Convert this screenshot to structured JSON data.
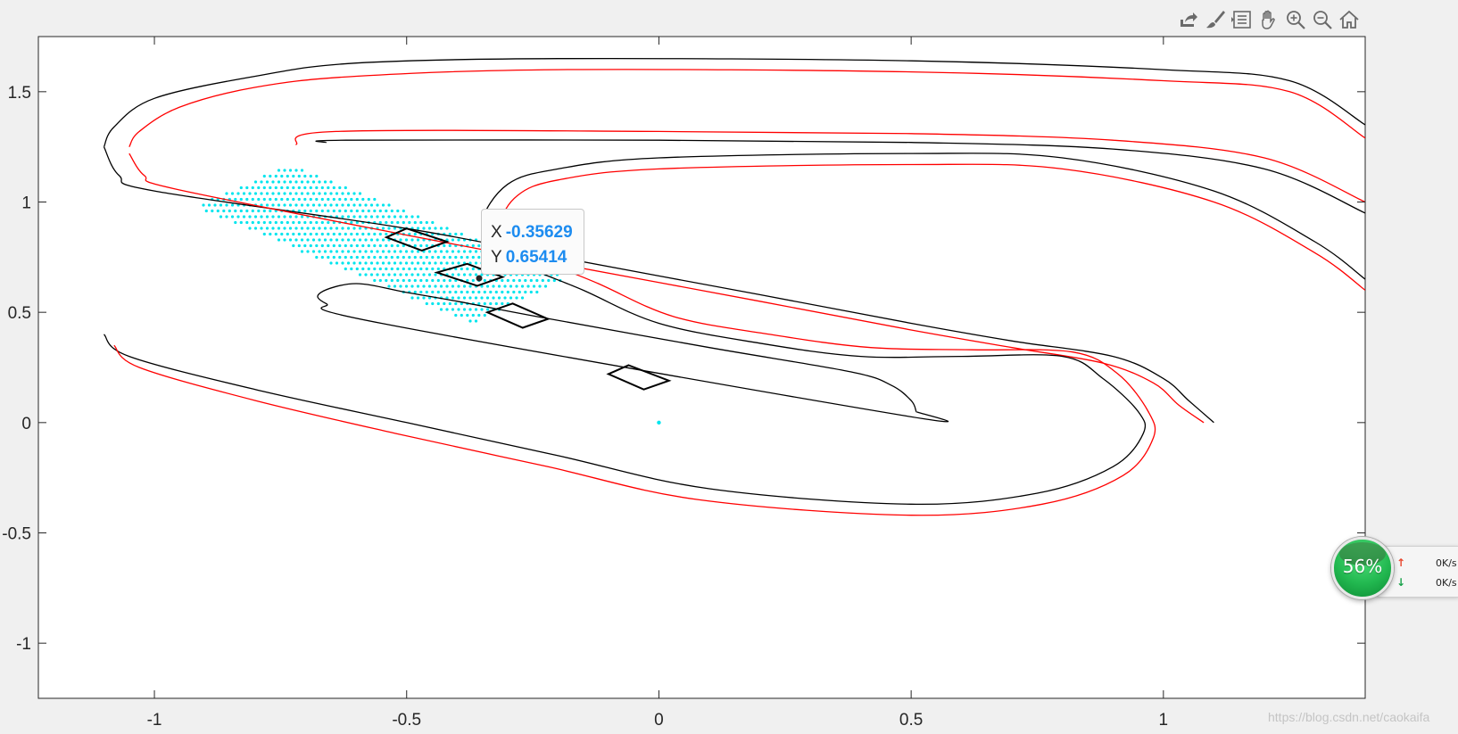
{
  "toolbar": {
    "icons": [
      "export-icon",
      "brush-icon",
      "legend-icon",
      "pan-hand-icon",
      "zoom-in-icon",
      "zoom-out-icon",
      "home-icon"
    ]
  },
  "chart_data": {
    "type": "line",
    "title": "",
    "xlabel": "",
    "ylabel": "",
    "xlim": [
      -1.23,
      1.4
    ],
    "ylim": [
      -1.25,
      1.75
    ],
    "xticks": [
      -1,
      -0.5,
      0,
      0.5,
      1
    ],
    "xtick_labels": [
      "-1",
      "-0.5",
      "0",
      "0.5",
      "1"
    ],
    "yticks": [
      1.5,
      1,
      0.5,
      0,
      -0.5,
      -1
    ],
    "ytick_labels": [
      "1.5",
      "1",
      "0.5",
      "0",
      "-0.5",
      "-1"
    ],
    "grid": false,
    "colors": {
      "boundary": "#000000",
      "offset": "#ff0000",
      "samples": "#00e5ee"
    },
    "series": [
      {
        "color": "#000000",
        "points": [
          [
            0.51,
            0.05
          ],
          [
            0.49,
            0.03
          ],
          [
            -0.55,
            0.45
          ],
          [
            -0.66,
            0.54
          ],
          [
            -0.67,
            0.59
          ],
          [
            -0.6,
            0.63
          ],
          [
            -0.5,
            0.59
          ],
          [
            -0.4,
            0.55
          ],
          [
            -0.24,
            0.48
          ],
          [
            0.1,
            0.34
          ],
          [
            0.38,
            0.23
          ],
          [
            0.46,
            0.17
          ],
          [
            0.5,
            0.1
          ],
          [
            0.51,
            0.05
          ]
        ]
      },
      {
        "color": "#000000",
        "points": [
          [
            -1.1,
            1.25
          ],
          [
            -1.08,
            1.34
          ],
          [
            -1.0,
            1.47
          ],
          [
            -0.8,
            1.57
          ],
          [
            -0.6,
            1.63
          ],
          [
            -0.2,
            1.65
          ],
          [
            0.5,
            1.64
          ],
          [
            1.0,
            1.6
          ],
          [
            1.25,
            1.55
          ],
          [
            1.4,
            1.35
          ]
        ]
      },
      {
        "color": "#ff0000",
        "points": [
          [
            -1.05,
            1.25
          ],
          [
            -1.03,
            1.32
          ],
          [
            -0.95,
            1.43
          ],
          [
            -0.8,
            1.52
          ],
          [
            -0.6,
            1.57
          ],
          [
            -0.2,
            1.6
          ],
          [
            0.5,
            1.59
          ],
          [
            1.0,
            1.55
          ],
          [
            1.25,
            1.5
          ],
          [
            1.4,
            1.29
          ]
        ]
      },
      {
        "color": "#000000",
        "points": [
          [
            -1.1,
            1.25
          ],
          [
            -1.07,
            1.12
          ],
          [
            -1.0,
            1.05
          ],
          [
            -0.5,
            0.88
          ],
          [
            -0.2,
            0.75
          ],
          [
            0.2,
            0.58
          ],
          [
            0.5,
            0.45
          ],
          [
            0.7,
            0.37
          ],
          [
            0.9,
            0.3
          ],
          [
            1.0,
            0.2
          ],
          [
            1.05,
            0.1
          ],
          [
            1.1,
            0.0
          ]
        ]
      },
      {
        "color": "#ff0000",
        "points": [
          [
            -1.05,
            1.22
          ],
          [
            -1.02,
            1.12
          ],
          [
            -0.96,
            1.06
          ],
          [
            -0.5,
            0.85
          ],
          [
            -0.2,
            0.72
          ],
          [
            0.2,
            0.55
          ],
          [
            0.5,
            0.42
          ],
          [
            0.7,
            0.34
          ],
          [
            0.88,
            0.27
          ],
          [
            0.98,
            0.18
          ],
          [
            1.03,
            0.08
          ],
          [
            1.08,
            0.0
          ]
        ]
      },
      {
        "color": "#000000",
        "points": [
          [
            -0.66,
            1.27
          ],
          [
            -0.62,
            1.28
          ],
          [
            0.0,
            1.28
          ],
          [
            0.5,
            1.27
          ],
          [
            0.9,
            1.24
          ],
          [
            1.2,
            1.15
          ],
          [
            1.4,
            0.95
          ]
        ]
      },
      {
        "color": "#ff0000",
        "points": [
          [
            -0.72,
            1.26
          ],
          [
            -0.64,
            1.32
          ],
          [
            0.0,
            1.32
          ],
          [
            0.5,
            1.31
          ],
          [
            0.9,
            1.28
          ],
          [
            1.2,
            1.2
          ],
          [
            1.4,
            1.0
          ]
        ]
      },
      {
        "color": "#000000",
        "points": [
          [
            1.4,
            0.65
          ],
          [
            1.3,
            0.82
          ],
          [
            1.1,
            1.05
          ],
          [
            0.8,
            1.2
          ],
          [
            0.5,
            1.22
          ],
          [
            0.0,
            1.2
          ],
          [
            -0.2,
            1.15
          ],
          [
            -0.3,
            1.08
          ],
          [
            -0.35,
            0.9
          ],
          [
            -0.3,
            0.75
          ],
          [
            -0.15,
            0.6
          ],
          [
            0.0,
            0.45
          ],
          [
            0.2,
            0.36
          ],
          [
            0.4,
            0.3
          ],
          [
            0.6,
            0.3
          ],
          [
            0.8,
            0.3
          ],
          [
            0.88,
            0.2
          ],
          [
            0.95,
            0.05
          ],
          [
            0.96,
            -0.05
          ],
          [
            0.9,
            -0.2
          ],
          [
            0.75,
            -0.32
          ],
          [
            0.5,
            -0.37
          ],
          [
            0.1,
            -0.3
          ],
          [
            -0.2,
            -0.15
          ],
          [
            -0.5,
            0.0
          ],
          [
            -0.8,
            0.15
          ],
          [
            -1.05,
            0.3
          ],
          [
            -1.1,
            0.4
          ]
        ]
      },
      {
        "color": "#ff0000",
        "points": [
          [
            1.4,
            0.6
          ],
          [
            1.3,
            0.77
          ],
          [
            1.1,
            1.0
          ],
          [
            0.8,
            1.15
          ],
          [
            0.5,
            1.17
          ],
          [
            0.0,
            1.15
          ],
          [
            -0.2,
            1.1
          ],
          [
            -0.28,
            1.03
          ],
          [
            -0.31,
            0.9
          ],
          [
            -0.26,
            0.77
          ],
          [
            -0.12,
            0.63
          ],
          [
            0.03,
            0.48
          ],
          [
            0.22,
            0.4
          ],
          [
            0.42,
            0.34
          ],
          [
            0.62,
            0.33
          ],
          [
            0.82,
            0.32
          ],
          [
            0.91,
            0.22
          ],
          [
            0.97,
            0.05
          ],
          [
            0.98,
            -0.07
          ],
          [
            0.92,
            -0.24
          ],
          [
            0.76,
            -0.37
          ],
          [
            0.5,
            -0.42
          ],
          [
            0.08,
            -0.35
          ],
          [
            -0.22,
            -0.2
          ],
          [
            -0.52,
            -0.05
          ],
          [
            -0.8,
            0.1
          ],
          [
            -1.03,
            0.25
          ],
          [
            -1.08,
            0.35
          ]
        ]
      }
    ],
    "rectangles": [
      {
        "color": "#000000",
        "corners": [
          [
            -0.5,
            0.88
          ],
          [
            -0.42,
            0.82
          ],
          [
            -0.47,
            0.78
          ],
          [
            -0.54,
            0.84
          ]
        ]
      },
      {
        "color": "#000000",
        "corners": [
          [
            -0.38,
            0.72
          ],
          [
            -0.31,
            0.66
          ],
          [
            -0.36,
            0.62
          ],
          [
            -0.44,
            0.68
          ]
        ]
      },
      {
        "color": "#000000",
        "corners": [
          [
            -0.29,
            0.54
          ],
          [
            -0.22,
            0.47
          ],
          [
            -0.27,
            0.43
          ],
          [
            -0.34,
            0.5
          ]
        ]
      },
      {
        "color": "#000000",
        "corners": [
          [
            -0.06,
            0.26
          ],
          [
            0.02,
            0.19
          ],
          [
            -0.03,
            0.15
          ],
          [
            -0.1,
            0.22
          ]
        ]
      }
    ],
    "sample_region": {
      "color": "#00e5ee",
      "polygon": [
        [
          -0.92,
          0.98
        ],
        [
          -0.73,
          1.17
        ],
        [
          -0.18,
          0.66
        ],
        [
          -0.37,
          0.45
        ]
      ]
    },
    "highlight_point": {
      "x": 0.0,
      "y": 0.0,
      "color": "#00e5ee"
    },
    "datatip": {
      "x": -0.35629,
      "y": 0.65414
    }
  },
  "datatip": {
    "x_label": "X",
    "x_value": "-0.35629",
    "y_label": "Y",
    "y_value": "0.65414"
  },
  "network_monitor": {
    "percent": "56%",
    "upload_rate": "0K/s",
    "download_rate": "0K/s",
    "upload_icon": "upload-arrow-icon",
    "download_icon": "download-arrow-icon"
  },
  "watermark": "https://blog.csdn.net/caokaifa"
}
